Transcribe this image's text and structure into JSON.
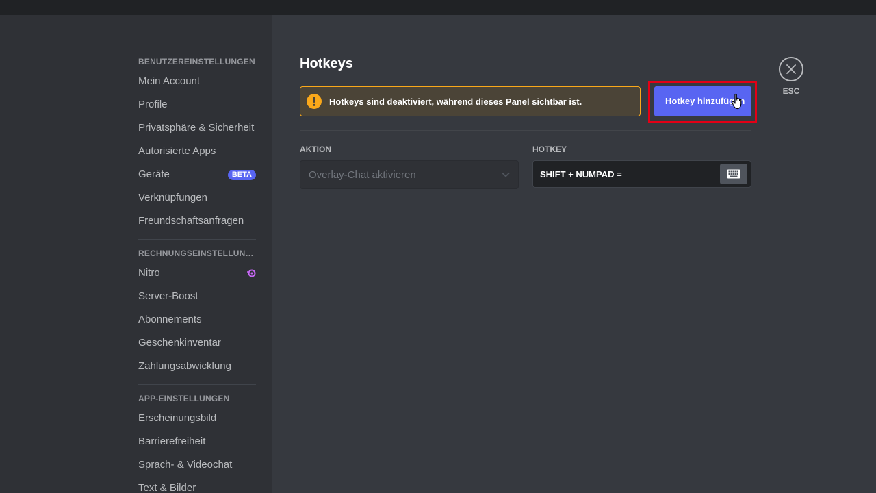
{
  "sidebar": {
    "sections": [
      {
        "header": "Benutzereinstellungen",
        "items": [
          {
            "label": "Mein Account"
          },
          {
            "label": "Profile"
          },
          {
            "label": "Privatsphäre & Sicherheit"
          },
          {
            "label": "Autorisierte Apps"
          },
          {
            "label": "Geräte",
            "badge": "BETA"
          },
          {
            "label": "Verknüpfungen"
          },
          {
            "label": "Freundschaftsanfragen"
          }
        ]
      },
      {
        "header": "Rechnungseinstellungen",
        "items": [
          {
            "label": "Nitro",
            "icon": "nitro-icon"
          },
          {
            "label": "Server-Boost"
          },
          {
            "label": "Abonnements"
          },
          {
            "label": "Geschenkinventar"
          },
          {
            "label": "Zahlungsabwicklung"
          }
        ]
      },
      {
        "header": "App-Einstellungen",
        "items": [
          {
            "label": "Erscheinungsbild"
          },
          {
            "label": "Barrierefreiheit"
          },
          {
            "label": "Sprach- & Videochat"
          },
          {
            "label": "Text & Bilder"
          }
        ]
      }
    ]
  },
  "main": {
    "title": "Hotkeys",
    "warning": {
      "text": "Hotkeys sind deaktiviert, während dieses Panel sichtbar ist.",
      "icon": "exclamation-icon"
    },
    "add_button": "Hotkey hinzufügen",
    "close": {
      "esc_label": "ESC",
      "icon": "close-icon"
    },
    "columns": {
      "action": "Aktion",
      "hotkey": "Hotkey"
    },
    "row": {
      "action_value": "Overlay-Chat aktivieren",
      "hotkey_value": "SHIFT + NUMPAD ="
    }
  },
  "colors": {
    "brand": "#5865f2",
    "warning": "#faa81a",
    "highlight": "#e30016",
    "nitro": "#c768f5"
  }
}
